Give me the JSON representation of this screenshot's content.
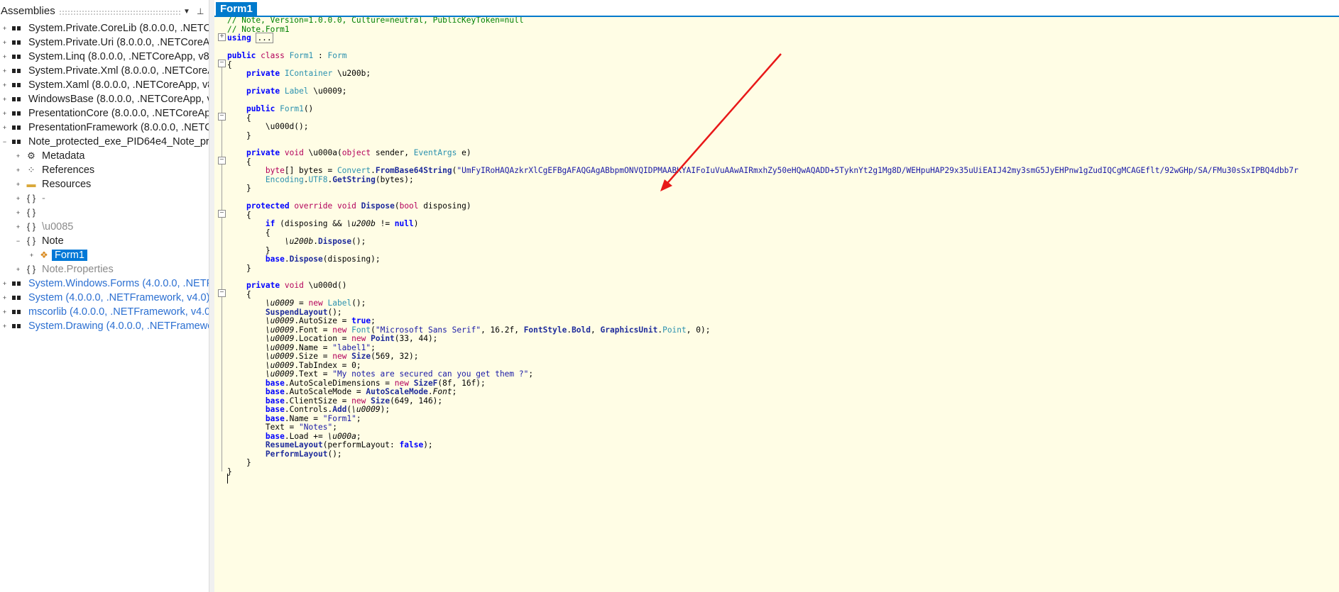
{
  "assemblies_panel": {
    "title": "Assemblies",
    "items": [
      {
        "label": "System.Private.CoreLib (8.0.0.0, .NETCo"
      },
      {
        "label": "System.Private.Uri (8.0.0.0, .NETCoreAp"
      },
      {
        "label": "System.Linq (8.0.0.0, .NETCoreApp, v8.0"
      },
      {
        "label": "System.Private.Xml (8.0.0.0, .NETCoreAp"
      },
      {
        "label": "System.Xaml (8.0.0.0, .NETCoreApp, v8."
      },
      {
        "label": "WindowsBase (8.0.0.0, .NETCoreApp, v8"
      },
      {
        "label": "PresentationCore (8.0.0.0, .NETCoreApp"
      },
      {
        "label": "PresentationFramework (8.0.0.0, .NETCo"
      },
      {
        "label": "Note_protected_exe_PID64e4_Note_pr"
      },
      {
        "label": "Metadata"
      },
      {
        "label": "References"
      },
      {
        "label": "Resources"
      },
      {
        "label": "-"
      },
      {
        "label": ""
      },
      {
        "label": "\\u0085"
      },
      {
        "label": "Note"
      },
      {
        "label": "Form1"
      },
      {
        "label": "Note.Properties"
      },
      {
        "label": "System.Windows.Forms (4.0.0.0, .NETFr"
      },
      {
        "label": "System (4.0.0.0, .NETFramework, v4.0)"
      },
      {
        "label": "mscorlib (4.0.0.0, .NETFramework, v4.0)"
      },
      {
        "label": "System.Drawing (4.0.0.0, .NETFramewo"
      }
    ],
    "namespace_glyph": "{ }"
  },
  "editor": {
    "tab_label": "Form1",
    "comment1": "// Note, Version=1.0.0.0, Culture=neutral, PublicKeyToken=null",
    "comment2": "// Note.Form1",
    "using_kw": "using",
    "using_collapsed": "...",
    "base64_literal": "\"UmFyIRoHAQAzkrXlCgEFBgAFAQGAgABbpmONVQIDPMAABKYAIFoIuVuAAwAIRmxhZy50eHQwAQADD+5TyknYt2g1Mg8D/WEHpuHAP29x35uUiEAIJ42my3smG5JyEHPnw1gZudIQCgMCAGEflt/92wGHp/SA/FMu30sSxIPBQ4dbb7r",
    "label_font_name": "\"Microsoft Sans Serif\"",
    "label_name": "\"label1\"",
    "label_text": "\"My notes are secured can you get them ?\"",
    "form_name": "\"Form1\"",
    "form_text": "\"Notes\""
  },
  "annotation": {
    "arrow_color": "#e81818"
  },
  "colors": {
    "accent": "#007acc",
    "editor_bg": "#fffde5",
    "keyword": "#0000ff",
    "comment": "#008000",
    "type": "#2b91af"
  }
}
